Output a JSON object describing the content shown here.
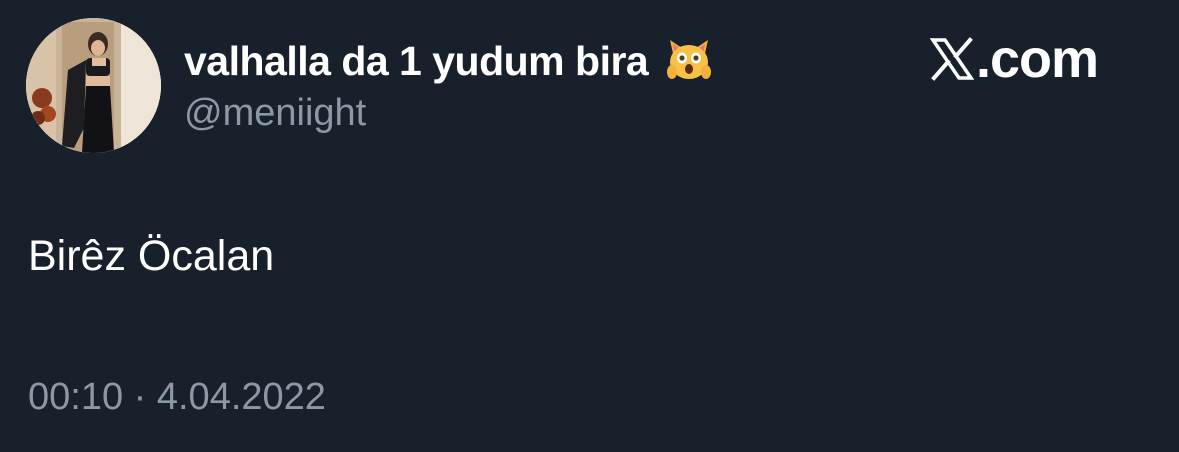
{
  "author": {
    "display_name": "valhalla da 1 yudum bira",
    "emoji": "scream-cat-emoji",
    "handle": "@meniight"
  },
  "brand": {
    "label": ".com",
    "icon": "x-logo-icon"
  },
  "tweet": {
    "text": "Birêz Öcalan",
    "timestamp": "00:10 · 4.04.2022"
  },
  "colors": {
    "background": "#17202b",
    "primary_text": "#ffffff",
    "secondary_text": "#8b98a5"
  }
}
